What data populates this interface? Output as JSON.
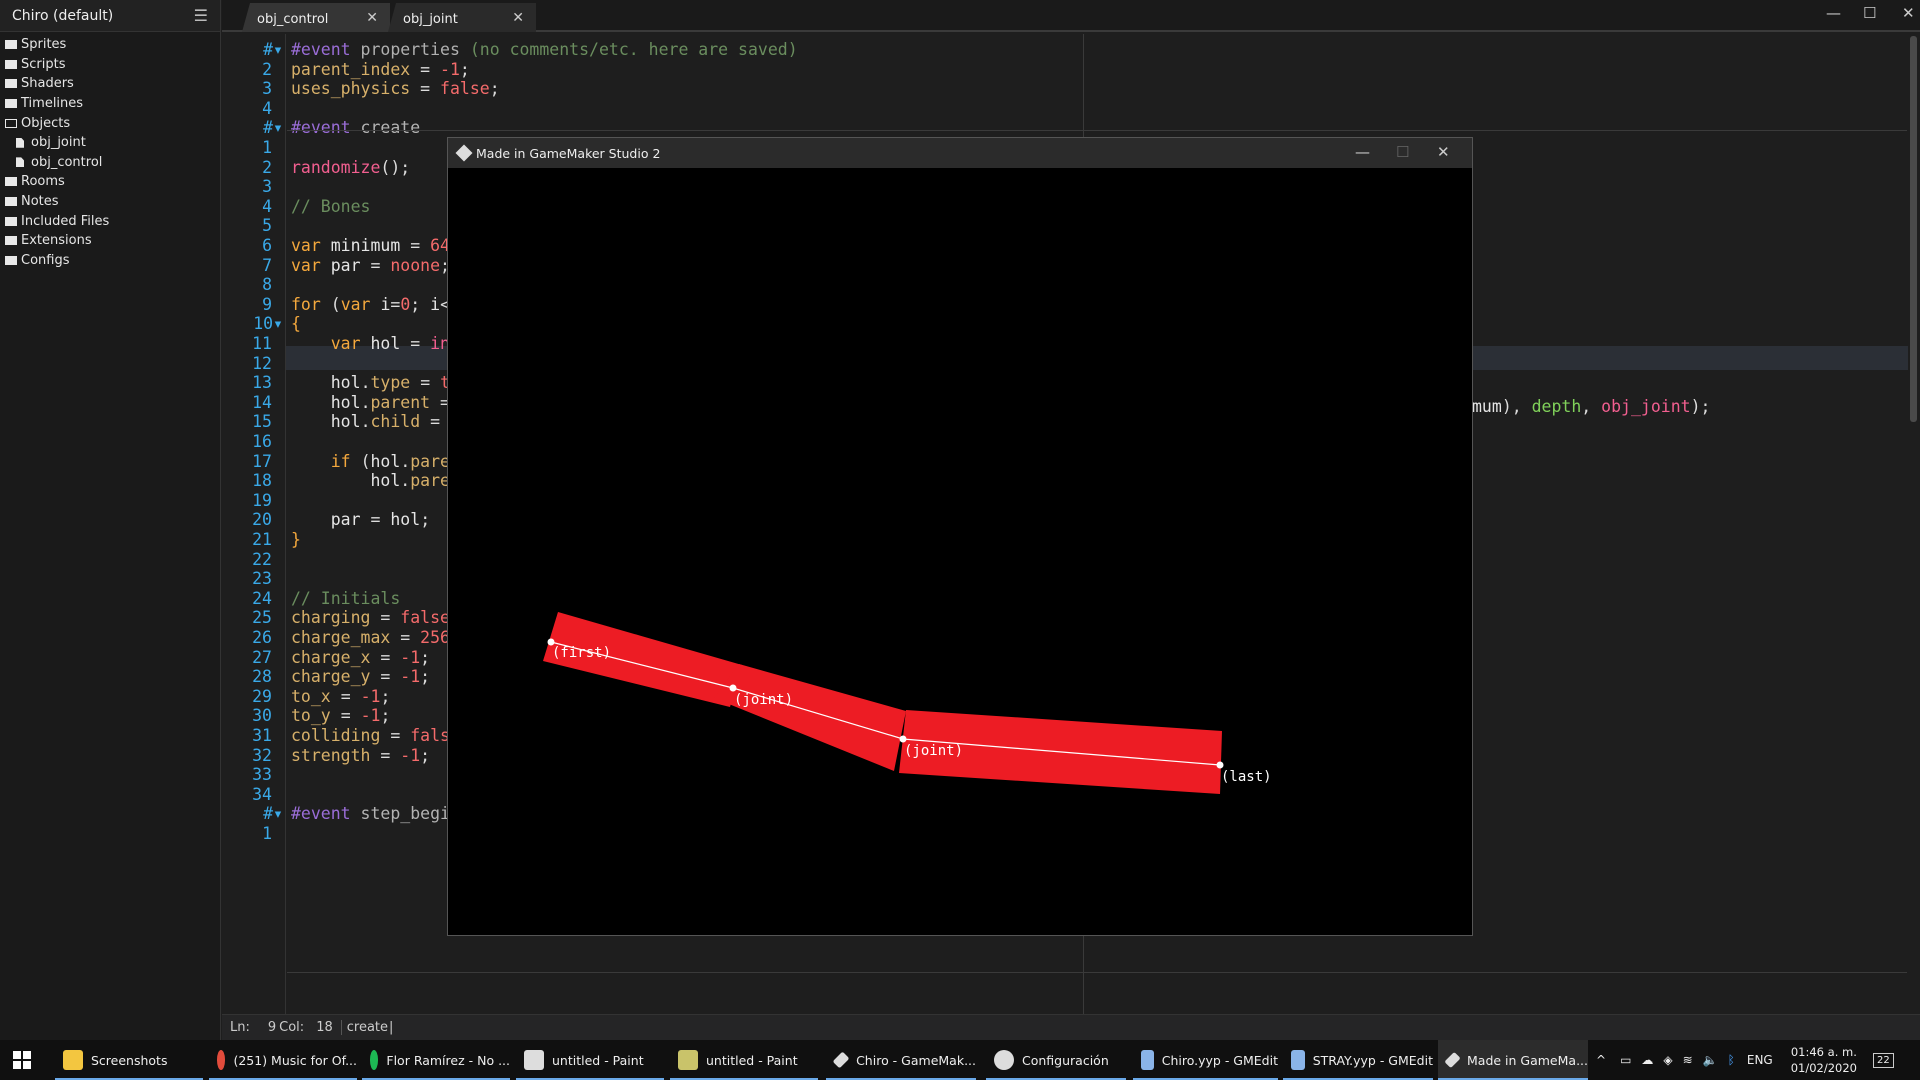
{
  "sidebar": {
    "title": "Chiro (default)",
    "items": [
      {
        "label": "Sprites",
        "type": "folder"
      },
      {
        "label": "Scripts",
        "type": "folder"
      },
      {
        "label": "Shaders",
        "type": "folder"
      },
      {
        "label": "Timelines",
        "type": "folder"
      },
      {
        "label": "Objects",
        "type": "folder-open"
      },
      {
        "label": "obj_joint",
        "type": "file"
      },
      {
        "label": "obj_control",
        "type": "file"
      },
      {
        "label": "Rooms",
        "type": "folder"
      },
      {
        "label": "Notes",
        "type": "folder"
      },
      {
        "label": "Included Files",
        "type": "folder"
      },
      {
        "label": "Extensions",
        "type": "folder"
      },
      {
        "label": "Configs",
        "type": "folder"
      }
    ]
  },
  "tabs": [
    {
      "label": "obj_control",
      "active": true
    },
    {
      "label": "obj_joint",
      "active": false
    }
  ],
  "editor": {
    "lines": [
      {
        "num": "#",
        "fold": true,
        "html": "<span class='c-dir'>#event</span> <span class='c-fn'>properties</span> <span class='c-cm'>(no comments/etc. here are saved)</span>"
      },
      {
        "num": "2",
        "html": "<span class='c-vr'>parent_index</span> <span class='c-op'>=</span> <span class='c-num'>-1</span><span class='c-op'>;</span>"
      },
      {
        "num": "3",
        "html": "<span class='c-vr'>uses_physics</span> <span class='c-op'>=</span> <span class='c-num'>false</span><span class='c-op'>;</span>"
      },
      {
        "num": "4",
        "html": ""
      },
      {
        "num": "#",
        "fold": true,
        "html": "<span class='c-dir'>#event</span> <span class='c-ev'>create</span>"
      },
      {
        "num": "1",
        "html": ""
      },
      {
        "num": "2",
        "html": "<span class='c-obj'>randomize</span><span class='c-op'>();</span>"
      },
      {
        "num": "3",
        "html": ""
      },
      {
        "num": "4",
        "html": "<span class='c-cm'>// Bones</span>"
      },
      {
        "num": "5",
        "html": ""
      },
      {
        "num": "6",
        "html": "<span class='c-kw'>var</span> <span class='c-pl'>minimum</span> <span class='c-op'>=</span> <span class='c-num'>64</span>"
      },
      {
        "num": "7",
        "html": "<span class='c-kw'>var</span> <span class='c-pl'>par</span> <span class='c-op'>=</span> <span class='c-num'>noone</span><span class='c-op'>;</span>"
      },
      {
        "num": "8",
        "html": ""
      },
      {
        "num": "9",
        "html": "<span class='c-kw'>for</span> <span class='c-op'>(</span><span class='c-kw'>var</span> <span class='c-pl'>i</span><span class='c-op'>=</span><span class='c-num'>0</span><span class='c-op'>;</span> <span class='c-pl'>i</span><span class='c-op'>&lt;</span>"
      },
      {
        "num": "10",
        "fold": true,
        "html": "<span class='c-kw'>{</span>"
      },
      {
        "num": "11",
        "html": "    <span class='c-kw'>var</span> <span class='c-pl'>hol</span> <span class='c-op'>=</span> <span class='c-obj'>in</span>"
      },
      {
        "num": "12",
        "html": ""
      },
      {
        "num": "13",
        "html": "    <span class='c-pl'>hol</span><span class='c-op'>.</span><span class='c-vr'>type</span> <span class='c-op'>=</span> <span class='c-num'>t</span>"
      },
      {
        "num": "14",
        "html": "    <span class='c-pl'>hol</span><span class='c-op'>.</span><span class='c-vr'>parent</span> <span class='c-op'>=</span>"
      },
      {
        "num": "15",
        "html": "    <span class='c-pl'>hol</span><span class='c-op'>.</span><span class='c-vr'>child</span> <span class='c-op'>=</span>"
      },
      {
        "num": "16",
        "html": ""
      },
      {
        "num": "17",
        "html": "    <span class='c-kw'>if</span> <span class='c-op'>(</span><span class='c-pl'>hol</span><span class='c-op'>.</span><span class='c-vr'>pare</span>"
      },
      {
        "num": "18",
        "html": "        <span class='c-pl'>hol</span><span class='c-op'>.</span><span class='c-vr'>pare</span>"
      },
      {
        "num": "19",
        "html": ""
      },
      {
        "num": "20",
        "html": "    <span class='c-pl'>par</span> <span class='c-op'>=</span> <span class='c-pl'>hol</span><span class='c-op'>;</span>"
      },
      {
        "num": "21",
        "html": "<span class='c-kw'>}</span>"
      },
      {
        "num": "22",
        "html": ""
      },
      {
        "num": "23",
        "html": ""
      },
      {
        "num": "24",
        "html": "<span class='c-cm'>// Initials</span>"
      },
      {
        "num": "25",
        "html": "<span class='c-vr'>charging</span> <span class='c-op'>=</span> <span class='c-num'>false</span>"
      },
      {
        "num": "26",
        "html": "<span class='c-vr'>charge_max</span> <span class='c-op'>=</span> <span class='c-num'>256</span>"
      },
      {
        "num": "27",
        "html": "<span class='c-vr'>charge_x</span> <span class='c-op'>=</span> <span class='c-num'>-1</span><span class='c-op'>;</span>"
      },
      {
        "num": "28",
        "html": "<span class='c-vr'>charge_y</span> <span class='c-op'>=</span> <span class='c-num'>-1</span><span class='c-op'>;</span>"
      },
      {
        "num": "29",
        "html": "<span class='c-vr'>to_x</span> <span class='c-op'>=</span> <span class='c-num'>-1</span><span class='c-op'>;</span>"
      },
      {
        "num": "30",
        "html": "<span class='c-vr'>to_y</span> <span class='c-op'>=</span> <span class='c-num'>-1</span><span class='c-op'>;</span>"
      },
      {
        "num": "31",
        "html": "<span class='c-vr'>colliding</span> <span class='c-op'>=</span> <span class='c-num'>fals</span>"
      },
      {
        "num": "32",
        "html": "<span class='c-vr'>strength</span> <span class='c-op'>=</span> <span class='c-num'>-1</span><span class='c-op'>;</span>"
      },
      {
        "num": "33",
        "html": ""
      },
      {
        "num": "34",
        "html": ""
      },
      {
        "num": "#",
        "fold": true,
        "html": "<span class='c-dir'>#event</span> <span class='c-ev'>step_begin</span>"
      },
      {
        "num": "1",
        "html": ""
      }
    ],
    "line11_tail_html": "<span class='c-pl'>mum</span><span class='c-op'>),</span> <span class='c-bi'>depth</span><span class='c-op'>,</span> <span class='c-obj'>obj_joint</span><span class='c-op'>);</span>"
  },
  "status": {
    "ln_label": "Ln:",
    "ln_value": "9",
    "col_label": "Col:",
    "col_value": "18",
    "event": "create"
  },
  "game_window": {
    "title": "Made in GameMaker Studio 2",
    "labels": [
      "(first)",
      "(joint)",
      "(joint)",
      "(last)"
    ],
    "colors": {
      "segment": "#ed1c24",
      "line": "#ffffff",
      "label": "#ffffff"
    }
  },
  "taskbar": {
    "items": [
      {
        "label": "Screenshots",
        "icon": "folder-icon",
        "color": "#f3c640"
      },
      {
        "label": "(251) Music for Of...",
        "icon": "chrome-icon",
        "color": "#e24c3c"
      },
      {
        "label": "Flor Ramírez - No ...",
        "icon": "spotify-icon",
        "color": "#1db954"
      },
      {
        "label": "untitled - Paint",
        "icon": "paint-icon",
        "color": "#dddddd"
      },
      {
        "label": "untitled - Paint",
        "icon": "paint-icon",
        "color": "#c9c36a"
      },
      {
        "label": "Chiro - GameMak...",
        "icon": "gamemaker-icon",
        "color": "#dddddd"
      },
      {
        "label": "Configuración",
        "icon": "gear-icon",
        "color": "#dddddd"
      },
      {
        "label": "Chiro.yyp - GMEdit",
        "icon": "gmedit-icon",
        "color": "#8ab4e8"
      },
      {
        "label": "STRAY.yyp - GMEdit",
        "icon": "gmedit-icon",
        "color": "#8ab4e8"
      },
      {
        "label": "Made in GameMa...",
        "icon": "gamemaker-icon",
        "color": "#dddddd"
      }
    ],
    "tray": {
      "language": "ENG",
      "time": "01:46 a. m.",
      "date": "01/02/2020",
      "notifications": "22"
    }
  }
}
